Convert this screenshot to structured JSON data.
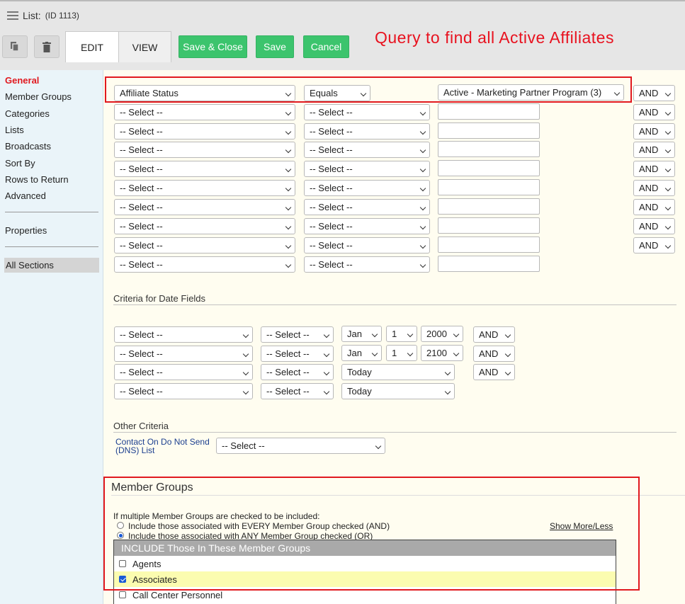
{
  "header": {
    "title": "List:",
    "id_label": "(ID 1113)",
    "tabs": [
      "EDIT",
      "VIEW"
    ],
    "buttons": {
      "save_close": "Save & Close",
      "save": "Save",
      "cancel": "Cancel"
    },
    "annotation": "Query to find all Active Affiliates"
  },
  "sidebar": {
    "items": [
      "General",
      "Member Groups",
      "Categories",
      "Lists",
      "Broadcasts",
      "Sort By",
      "Rows to Return",
      "Advanced"
    ],
    "properties": "Properties",
    "all_sections": "All Sections",
    "active": "General"
  },
  "criteria": {
    "rows": [
      {
        "field": "Affiliate Status",
        "operator": "Equals",
        "value": "Active - Marketing Partner Program (3)",
        "conj": "AND"
      },
      {
        "field": "-- Select --",
        "operator": "-- Select --",
        "value": "",
        "conj": "AND"
      },
      {
        "field": "-- Select --",
        "operator": "-- Select --",
        "value": "",
        "conj": "AND"
      },
      {
        "field": "-- Select --",
        "operator": "-- Select --",
        "value": "",
        "conj": "AND"
      },
      {
        "field": "-- Select --",
        "operator": "-- Select --",
        "value": "",
        "conj": "AND"
      },
      {
        "field": "-- Select --",
        "operator": "-- Select --",
        "value": "",
        "conj": "AND"
      },
      {
        "field": "-- Select --",
        "operator": "-- Select --",
        "value": "",
        "conj": "AND"
      },
      {
        "field": "-- Select --",
        "operator": "-- Select --",
        "value": "",
        "conj": "AND"
      },
      {
        "field": "-- Select --",
        "operator": "-- Select --",
        "value": "",
        "conj": "AND"
      },
      {
        "field": "-- Select --",
        "operator": "-- Select --",
        "value": "",
        "conj": ""
      }
    ]
  },
  "date_criteria": {
    "label": "Criteria for Date Fields",
    "rows": [
      {
        "field": "-- Select --",
        "operator": "-- Select --",
        "month": "Jan",
        "day": "1",
        "year": "2000",
        "conj": "AND"
      },
      {
        "field": "-- Select --",
        "operator": "-- Select --",
        "month": "Jan",
        "day": "1",
        "year": "2100",
        "conj": "AND"
      },
      {
        "field": "-- Select --",
        "operator": "-- Select --",
        "relative": "Today",
        "conj": "AND"
      },
      {
        "field": "-- Select --",
        "operator": "-- Select --",
        "relative": "Today",
        "conj": ""
      }
    ]
  },
  "other_criteria": {
    "label": "Other Criteria",
    "dns_label_line1": "Contact On Do Not Send",
    "dns_label_line2": "(DNS) List",
    "dns_value": "-- Select --"
  },
  "member_groups": {
    "title": "Member Groups",
    "instruction": "If multiple Member Groups are checked to be included:",
    "option_every": "Include those associated with EVERY Member Group checked (AND)",
    "option_any": "Include those associated with ANY Member Group checked (OR)",
    "selected_option": "any",
    "show_more": "Show More/Less",
    "include_header": "INCLUDE Those In These Member Groups",
    "groups": [
      {
        "name": "Agents",
        "checked": false
      },
      {
        "name": "Associates",
        "checked": true
      },
      {
        "name": "Call Center Personnel",
        "checked": false
      }
    ]
  },
  "colors": {
    "accent_green": "#3cc46d",
    "annotation_red": "#e8121f",
    "highlight_yellow": "#fbfcb0"
  }
}
